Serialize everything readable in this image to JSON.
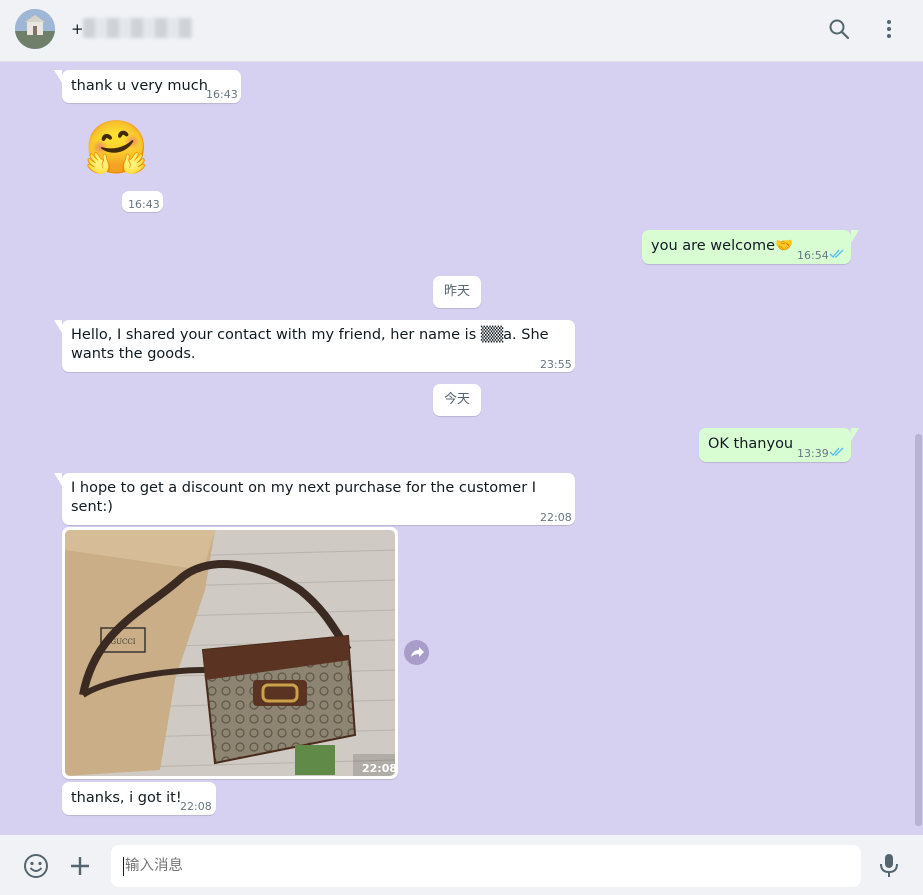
{
  "header": {
    "contact_prefix": "+",
    "search_icon": "search-icon",
    "menu_icon": "kebab-menu-icon"
  },
  "messages": {
    "m1": {
      "text": "thank u very much",
      "time": "16:43"
    },
    "m2": {
      "emoji": "🤗",
      "time": "16:43"
    },
    "m3": {
      "text": "you are welcome🤝",
      "time": "16:54"
    },
    "d1": {
      "label": "昨天"
    },
    "m4": {
      "text": "Hello, I shared your contact with my friend, her name is ▒▒a. She wants the goods.",
      "time": "23:55"
    },
    "d2": {
      "label": "今天"
    },
    "m5": {
      "text": "OK thanyou",
      "time": "13:39"
    },
    "m6": {
      "text": "I hope to get a discount on my next purchase for the customer I sent:)",
      "time": "22:08"
    },
    "m7": {
      "image_time": "22:08",
      "image_brand": "GUCCI"
    },
    "m8": {
      "text": "thanks, i got it!",
      "time": "22:08"
    }
  },
  "footer": {
    "placeholder": "输入消息"
  },
  "colors": {
    "chat_bg": "#d6d0f1",
    "incoming": "#ffffff",
    "outgoing": "#d9fdd3",
    "read_ticks": "#53bdeb"
  }
}
